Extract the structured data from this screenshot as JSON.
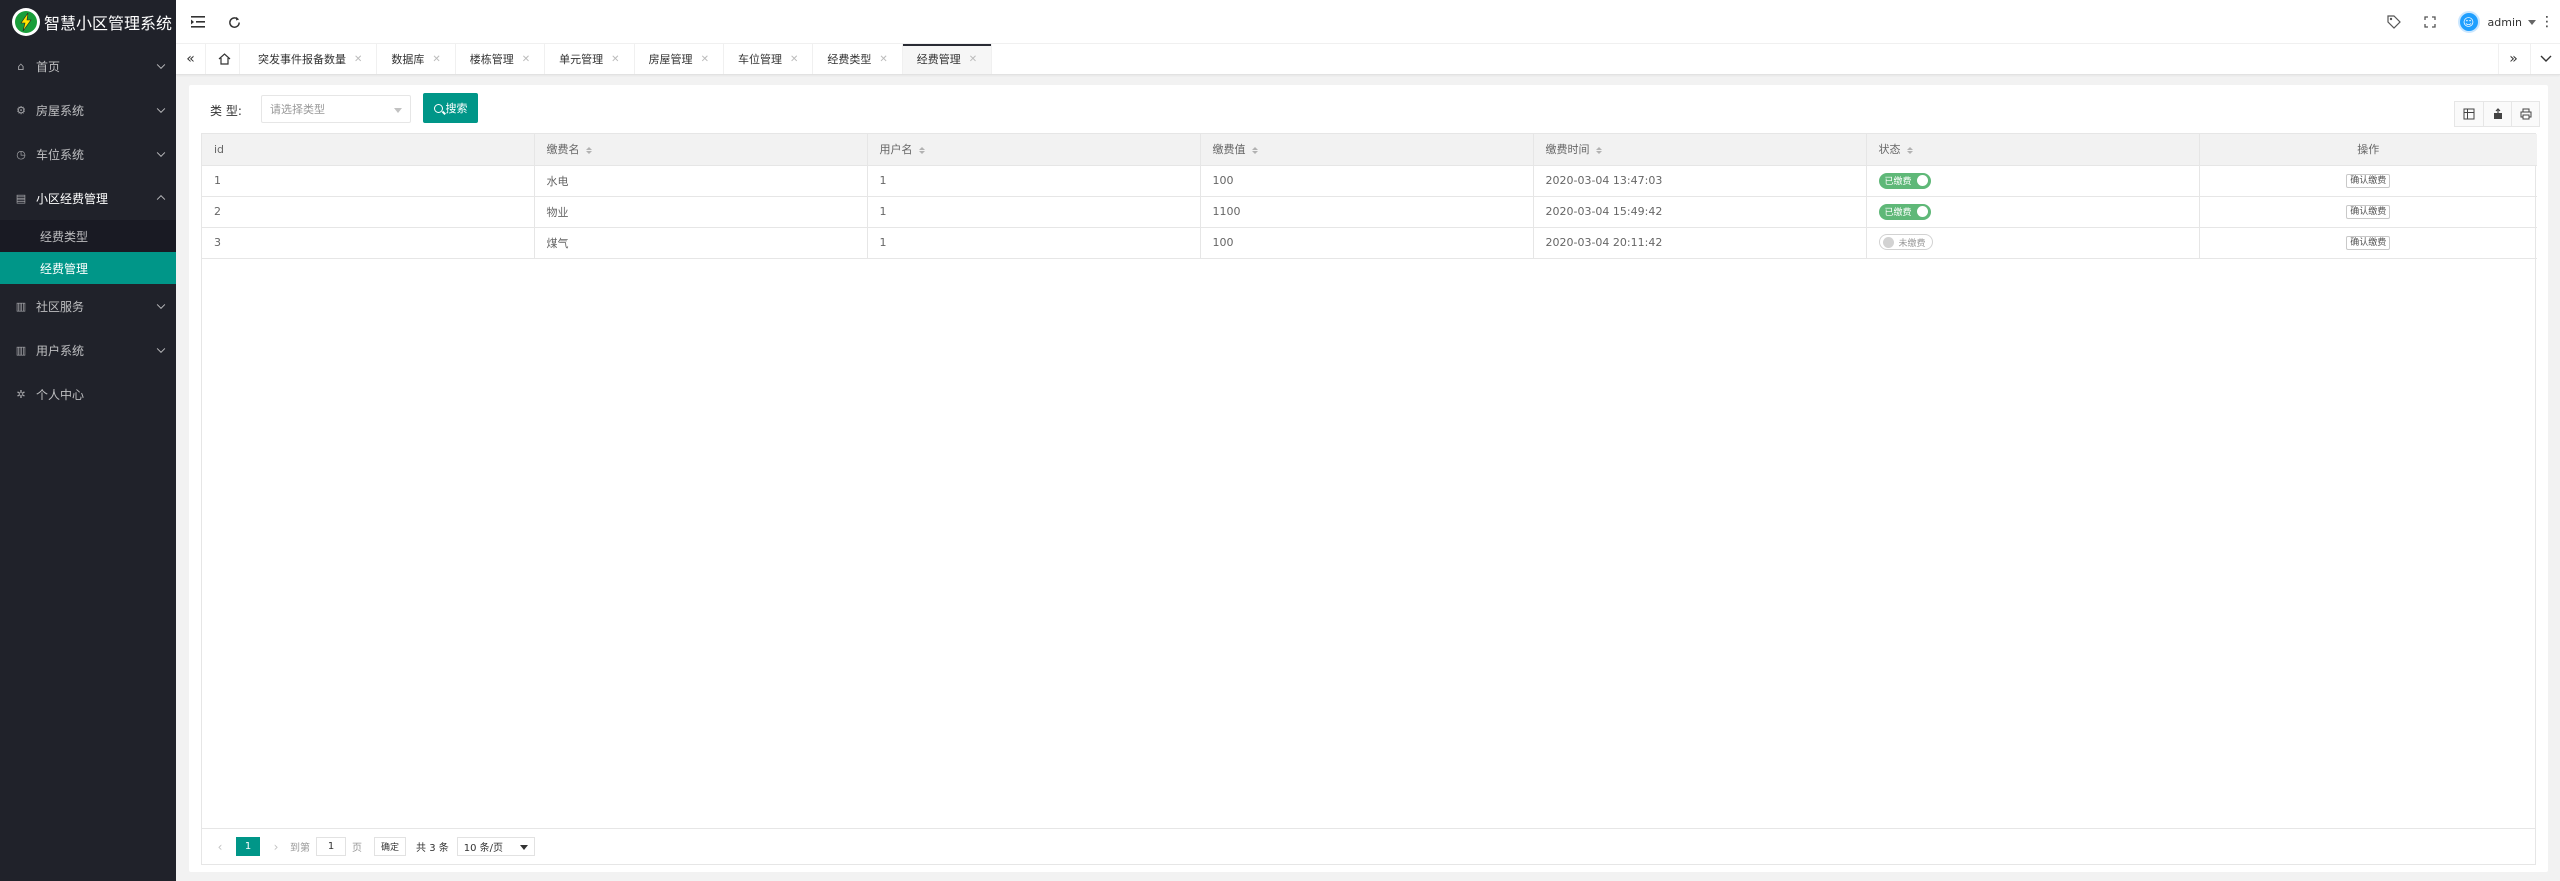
{
  "app": {
    "title": "智慧小区管理系统"
  },
  "sidebar": {
    "items": [
      {
        "label": "首页",
        "icon": "home-icon",
        "has_arrow": true
      },
      {
        "label": "房屋系统",
        "icon": "gear-icon",
        "has_arrow": true
      },
      {
        "label": "车位系统",
        "icon": "clock-icon",
        "has_arrow": true
      },
      {
        "label": "小区经费管理",
        "icon": "cards-icon",
        "has_arrow": true,
        "open": true
      },
      {
        "label": "社区服务",
        "icon": "chart-icon",
        "has_arrow": true
      },
      {
        "label": "用户系统",
        "icon": "chart-icon",
        "has_arrow": true
      },
      {
        "label": "个人中心",
        "icon": "settings-icon",
        "has_arrow": false
      }
    ],
    "subitems": [
      {
        "label": "经费类型",
        "active": false
      },
      {
        "label": "经费管理",
        "active": true
      }
    ]
  },
  "header": {
    "user": "admin"
  },
  "tabs": [
    {
      "label": "突发事件报备数量"
    },
    {
      "label": "数据库"
    },
    {
      "label": "楼栋管理"
    },
    {
      "label": "单元管理"
    },
    {
      "label": "房屋管理"
    },
    {
      "label": "车位管理"
    },
    {
      "label": "经费类型"
    },
    {
      "label": "经费管理",
      "active": true
    }
  ],
  "filter": {
    "label": "类 型:",
    "placeholder": "请选择类型",
    "search_label": "搜索"
  },
  "table": {
    "columns": [
      "id",
      "缴费名",
      "用户名",
      "缴费值",
      "缴费时间",
      "状态",
      "操作"
    ],
    "rows": [
      {
        "id": "1",
        "name": "水电",
        "user": "1",
        "amount": "100",
        "time": "2020-03-04 13:47:03",
        "status": "已缴费",
        "paid": true,
        "action": "确认缴费"
      },
      {
        "id": "2",
        "name": "物业",
        "user": "1",
        "amount": "1100",
        "time": "2020-03-04 15:49:42",
        "status": "已缴费",
        "paid": true,
        "action": "确认缴费"
      },
      {
        "id": "3",
        "name": "煤气",
        "user": "1",
        "amount": "100",
        "time": "2020-03-04 20:11:42",
        "status": "未缴费",
        "paid": false,
        "action": "确认缴费"
      }
    ]
  },
  "pager": {
    "current": "1",
    "goto_label": "到第",
    "goto_value": "1",
    "page_unit": "页",
    "confirm": "确定",
    "total": "共 3 条",
    "page_size": "10 条/页"
  },
  "colors": {
    "sidebar_bg": "#20222a",
    "accent": "#009688",
    "switch_on": "#5fb878"
  }
}
